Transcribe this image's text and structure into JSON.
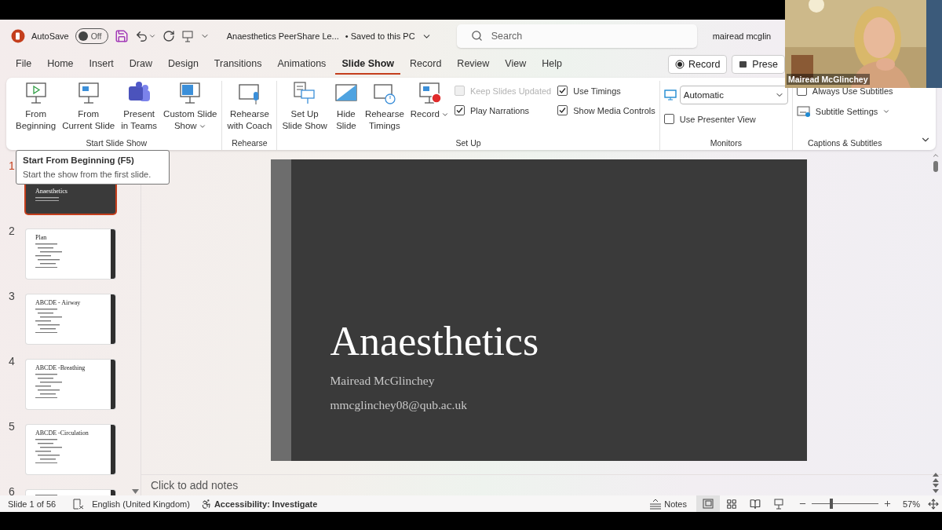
{
  "title_bar": {
    "autosave": {
      "label": "AutoSave",
      "on": false,
      "state_text": "Off"
    },
    "document": "Anaesthetics PeerShare Le...",
    "save_status": "• Saved to this PC",
    "search": {
      "placeholder": "Search"
    },
    "user": "mairead mcglin"
  },
  "tabs": [
    {
      "label": "File",
      "selected": false
    },
    {
      "label": "Home",
      "selected": false
    },
    {
      "label": "Insert",
      "selected": false
    },
    {
      "label": "Draw",
      "selected": false
    },
    {
      "label": "Design",
      "selected": false
    },
    {
      "label": "Transitions",
      "selected": false
    },
    {
      "label": "Animations",
      "selected": false
    },
    {
      "label": "Slide Show",
      "selected": true
    },
    {
      "label": "Record",
      "selected": false
    },
    {
      "label": "Review",
      "selected": false
    },
    {
      "label": "View",
      "selected": false
    },
    {
      "label": "Help",
      "selected": false
    }
  ],
  "header_buttons": [
    {
      "label": "Record"
    },
    {
      "label": "Prese"
    }
  ],
  "ribbon": {
    "groups": [
      {
        "label": "Start Slide Show",
        "buttons": [
          {
            "label": "From\nBeginning",
            "menu": false
          },
          {
            "label": "From\nCurrent Slide",
            "menu": false
          },
          {
            "label": "Present\nin Teams",
            "menu": false
          },
          {
            "label": "Custom Slide\nShow",
            "menu": true
          }
        ]
      },
      {
        "label": "Rehearse",
        "buttons": [
          {
            "label": "Rehearse\nwith Coach",
            "menu": false
          }
        ]
      },
      {
        "label": "Set Up",
        "buttons": [
          {
            "label": "Set Up\nSlide Show",
            "menu": false
          },
          {
            "label": "Hide\nSlide",
            "menu": false
          },
          {
            "label": "Rehearse\nTimings",
            "menu": false
          },
          {
            "label": "Record",
            "menu": true
          }
        ],
        "options": [
          {
            "kind": "checkbox",
            "label": "Keep Slides Updated",
            "checked": false,
            "disabled": true
          },
          {
            "kind": "checkbox",
            "label": "Use Timings",
            "checked": true,
            "disabled": false
          },
          {
            "kind": "checkbox",
            "label": "Play Narrations",
            "checked": true,
            "disabled": false
          },
          {
            "kind": "checkbox",
            "label": "Show Media Controls",
            "checked": true,
            "disabled": false
          }
        ]
      },
      {
        "label": "Monitors",
        "options": [
          {
            "kind": "select",
            "value": "Automatic"
          },
          {
            "kind": "checkbox",
            "label": "Use Presenter View",
            "checked": false,
            "disabled": false
          }
        ]
      },
      {
        "label": "Captions & Subtitles",
        "options": [
          {
            "kind": "checkbox",
            "label": "Always Use Subtitles",
            "checked": false,
            "disabled": false
          },
          {
            "kind": "menu",
            "label": "Subtitle Settings"
          }
        ]
      }
    ]
  },
  "tooltip": {
    "title": "Start From Beginning (F5)",
    "text": "Start the show from the first slide."
  },
  "thumbnails": [
    {
      "number": "1",
      "title": "Anaesthetics",
      "kind": "title",
      "selected": true
    },
    {
      "number": "2",
      "title": "Plan",
      "kind": "content",
      "selected": false
    },
    {
      "number": "3",
      "title": "ABCDE - Airway",
      "kind": "content",
      "selected": false
    },
    {
      "number": "4",
      "title": "ABCDE -Breathing",
      "kind": "content",
      "selected": false
    },
    {
      "number": "5",
      "title": "ABCDE -Circulation",
      "kind": "content",
      "selected": false
    },
    {
      "number": "6",
      "kind": "content",
      "selected": false
    }
  ],
  "slide": {
    "title": "Anaesthetics",
    "subtitle": "Mairead McGlinchey",
    "email": "mmcglinchey08@qub.ac.uk"
  },
  "notes": {
    "placeholder": "Click to add notes"
  },
  "status_bar": {
    "slide": "Slide 1 of 56",
    "language": "English (United Kingdom)",
    "accessibility": "Accessibility: Investigate",
    "notes": "Notes",
    "views": [
      {
        "selected": true
      },
      {
        "selected": false
      },
      {
        "selected": false
      },
      {
        "selected": false
      }
    ],
    "zoom": {
      "level": 0.3,
      "reading": "57%"
    }
  },
  "webcam": {
    "name": "Mairead McGlinchey"
  }
}
